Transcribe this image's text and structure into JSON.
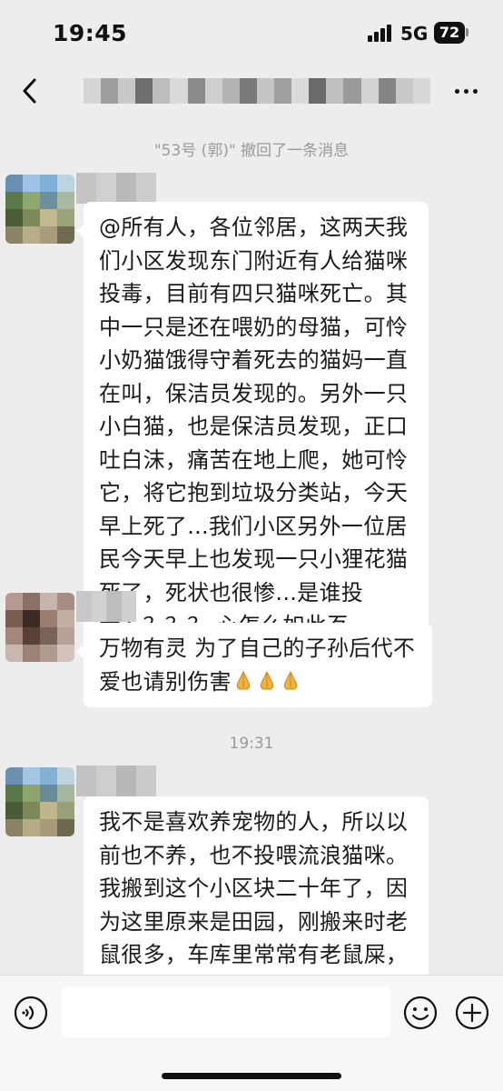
{
  "status_bar": {
    "time": "19:45",
    "network": "5G",
    "battery": "72"
  },
  "nav": {
    "back_icon": "chevron-left-icon",
    "more_icon": "ellipsis-icon"
  },
  "messages": {
    "recall_notice": "\"53号 (郭)\" 撤回了一条消息",
    "bubble1_text": "@所有人，各位邻居，这两天我们小区发现东门附近有人给猫咪投毒，目前有四只猫咪死亡。其中一只是还在喂奶的母猫，可怜小奶猫饿得守着死去的猫妈一直在叫，保洁员发现的。另外一只小白猫，也是保洁员发现，正口吐白沫，痛苦在地上爬，她可怜它，将它抱到垃圾分类站，今天早上死了...我们小区另外一位居民今天早上也发现一只小狸花猫死了，死状也很惨...是谁投毒？？？？ 心怎么如此歹毒！！！！",
    "bubble2_text": "万物有灵 为了自己的子孙后代不爱也请别伤害",
    "bubble2_emoji": "praying-hands-emoji",
    "timestamp": "19:31",
    "bubble3_text": "我不是喜欢养宠物的人，所以以前也不养，也不投喂流浪猫咪。我搬到这个小区块二十年了，因为这里原来是田园，刚搬来时老鼠很多，车库里常常有老鼠屎，后来，有一天有一只流浪猫进入"
  },
  "input_bar": {
    "input_value": "",
    "voice_icon": "voice-icon",
    "emoji_icon": "emoji-face-icon",
    "plus_icon": "plus-circle-icon"
  },
  "colors": {
    "background": "#ededed",
    "bubble": "#ffffff",
    "system_text": "#9a9a9a"
  }
}
